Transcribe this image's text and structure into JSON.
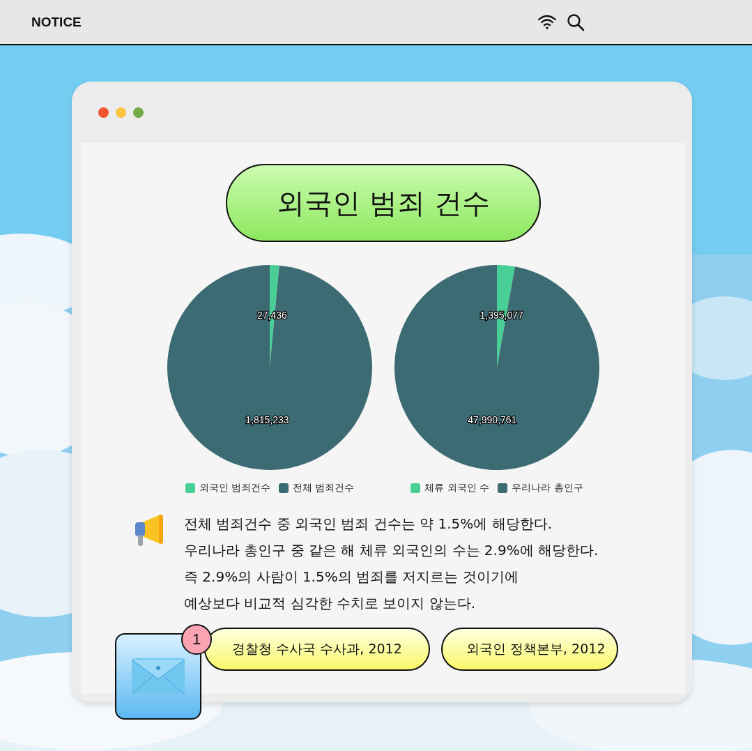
{
  "top_bar": {
    "title": "NOTICE"
  },
  "window": {
    "heading": "외국인 범죄 건수",
    "charts": [
      {
        "legend": [
          {
            "color": "#48cf96"
          },
          {
            "color": "#3d6b73"
          }
        ],
        "chart_data": {
          "type": "pie",
          "categories": [
            "외국인 범죄건수",
            "전체 범죄건수"
          ],
          "values": [
            27436,
            1815233
          ],
          "data_labels": true,
          "value_labels": [
            "27,436",
            "1,815,233"
          ]
        }
      },
      {
        "legend": [
          {
            "color": "#48cf96"
          },
          {
            "color": "#3d6b73"
          }
        ],
        "chart_data": {
          "type": "pie",
          "categories": [
            "체류 외국인 수",
            "우리나라 총인구"
          ],
          "values": [
            1395077,
            47990761
          ],
          "data_labels": true,
          "value_labels": [
            "1,395,077",
            "47,990,761"
          ]
        }
      }
    ],
    "notice_lines": [
      "전체 범죄건수 중 외국인 범죄 건수는 약 1.5%에 해당한다.",
      "우리나라 총인구 중 같은 해 체류 외국인의 수는 2.9%에 해당한다.",
      "즉 2.9%의 사람이 1.5%의 범죄를 저지르는 것이기에",
      "예상보다 비교적 심각한 수치로 보이지 않는다."
    ],
    "sources": [
      "경찰청 수사국 수사과, 2012",
      "외국인 정책본부, 2012"
    ]
  },
  "mail": {
    "badge": "1"
  }
}
